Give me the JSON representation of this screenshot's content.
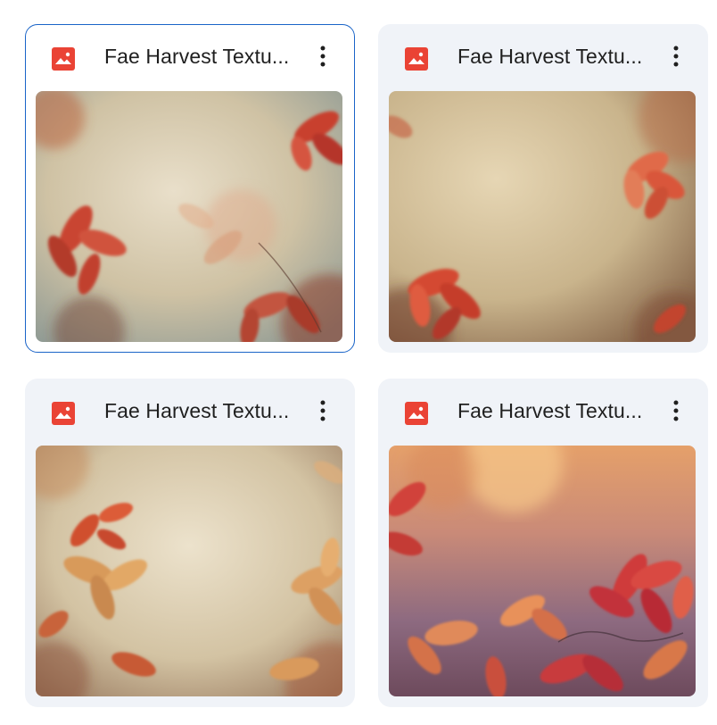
{
  "grid": {
    "items": [
      {
        "title": "Fae Harvest Textu...",
        "icon": "image-file-icon",
        "menu_icon": "more-vert-icon",
        "selected": true
      },
      {
        "title": "Fae Harvest Textu...",
        "icon": "image-file-icon",
        "menu_icon": "more-vert-icon",
        "selected": false
      },
      {
        "title": "Fae Harvest Textu...",
        "icon": "image-file-icon",
        "menu_icon": "more-vert-icon",
        "selected": false
      },
      {
        "title": "Fae Harvest Textu...",
        "icon": "image-file-icon",
        "menu_icon": "more-vert-icon",
        "selected": false
      }
    ]
  },
  "colors": {
    "selected_border": "#1a64c8",
    "card_bg": "#f0f3f8",
    "image_icon": "#ea4335"
  }
}
